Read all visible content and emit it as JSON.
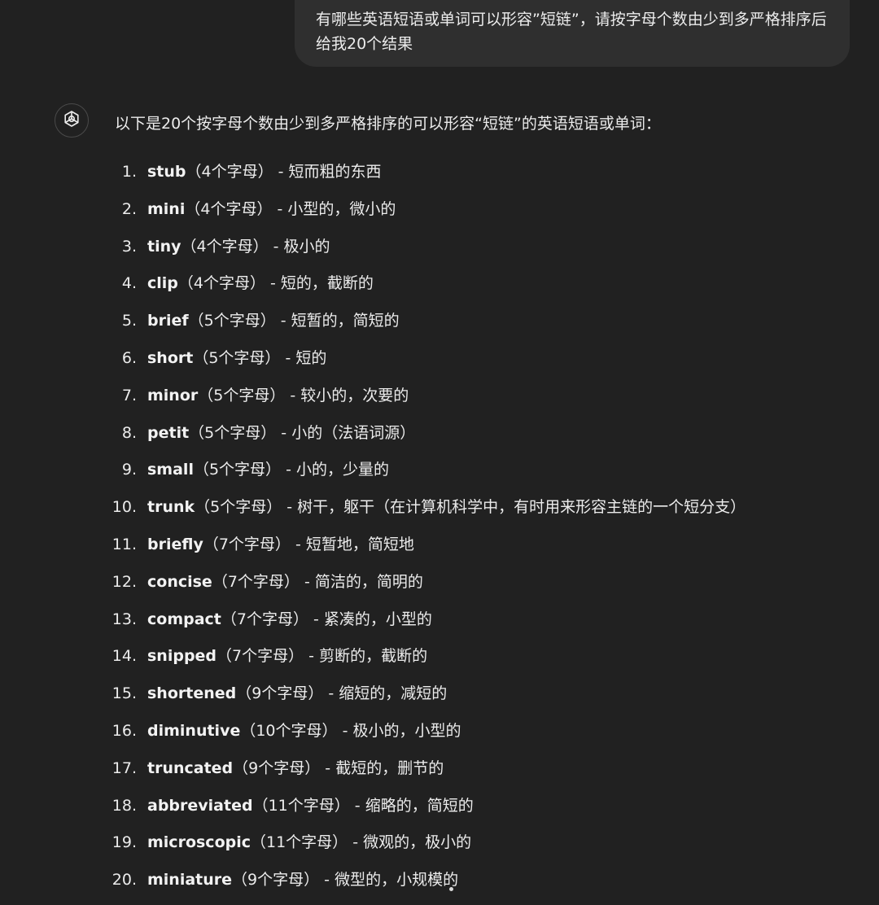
{
  "user_message": {
    "text": "有哪些英语短语或单词可以形容”短链”，请按字母个数由少到多严格排序后给我20个结果"
  },
  "assistant": {
    "icon": "openai-logo-icon",
    "intro": "以下是20个按字母个数由少到多严格排序的可以形容“短链”的英语短语或单词：",
    "items": [
      {
        "num": "1.",
        "word": "stub",
        "count": "（4个字母）",
        "meaning": " - 短而粗的东西"
      },
      {
        "num": "2.",
        "word": "mini",
        "count": "（4个字母）",
        "meaning": " - 小型的，微小的"
      },
      {
        "num": "3.",
        "word": "tiny",
        "count": "（4个字母）",
        "meaning": " - 极小的"
      },
      {
        "num": "4.",
        "word": "clip",
        "count": "（4个字母）",
        "meaning": " - 短的，截断的"
      },
      {
        "num": "5.",
        "word": "brief",
        "count": "（5个字母）",
        "meaning": " - 短暂的，简短的"
      },
      {
        "num": "6.",
        "word": "short",
        "count": "（5个字母）",
        "meaning": " - 短的"
      },
      {
        "num": "7.",
        "word": "minor",
        "count": "（5个字母）",
        "meaning": " - 较小的，次要的"
      },
      {
        "num": "8.",
        "word": "petit",
        "count": "（5个字母）",
        "meaning": " - 小的（法语词源）"
      },
      {
        "num": "9.",
        "word": "small",
        "count": "（5个字母）",
        "meaning": " - 小的，少量的"
      },
      {
        "num": "10.",
        "word": "trunk",
        "count": "（5个字母）",
        "meaning": " - 树干，躯干（在计算机科学中，有时用来形容主链的一个短分支）"
      },
      {
        "num": "11.",
        "word": "briefly",
        "count": "（7个字母）",
        "meaning": " - 短暂地，简短地"
      },
      {
        "num": "12.",
        "word": "concise",
        "count": "（7个字母）",
        "meaning": " - 简洁的，简明的"
      },
      {
        "num": "13.",
        "word": "compact",
        "count": "（7个字母）",
        "meaning": " - 紧凑的，小型的"
      },
      {
        "num": "14.",
        "word": "snipped",
        "count": "（7个字母）",
        "meaning": " - 剪断的，截断的"
      },
      {
        "num": "15.",
        "word": "shortened",
        "count": "（9个字母）",
        "meaning": " - 缩短的，减短的"
      },
      {
        "num": "16.",
        "word": "diminutive",
        "count": "（10个字母）",
        "meaning": " - 极小的，小型的"
      },
      {
        "num": "17.",
        "word": "truncated",
        "count": "（9个字母）",
        "meaning": " - 截短的，删节的"
      },
      {
        "num": "18.",
        "word": "abbreviated",
        "count": "（11个字母）",
        "meaning": " - 缩略的，简短的"
      },
      {
        "num": "19.",
        "word": "microscopic",
        "count": "（11个字母）",
        "meaning": " - 微观的，极小的"
      },
      {
        "num": "20.",
        "word": "miniature",
        "count": "（9个字母）",
        "meaning": " - 微型的，小规模的"
      }
    ]
  }
}
